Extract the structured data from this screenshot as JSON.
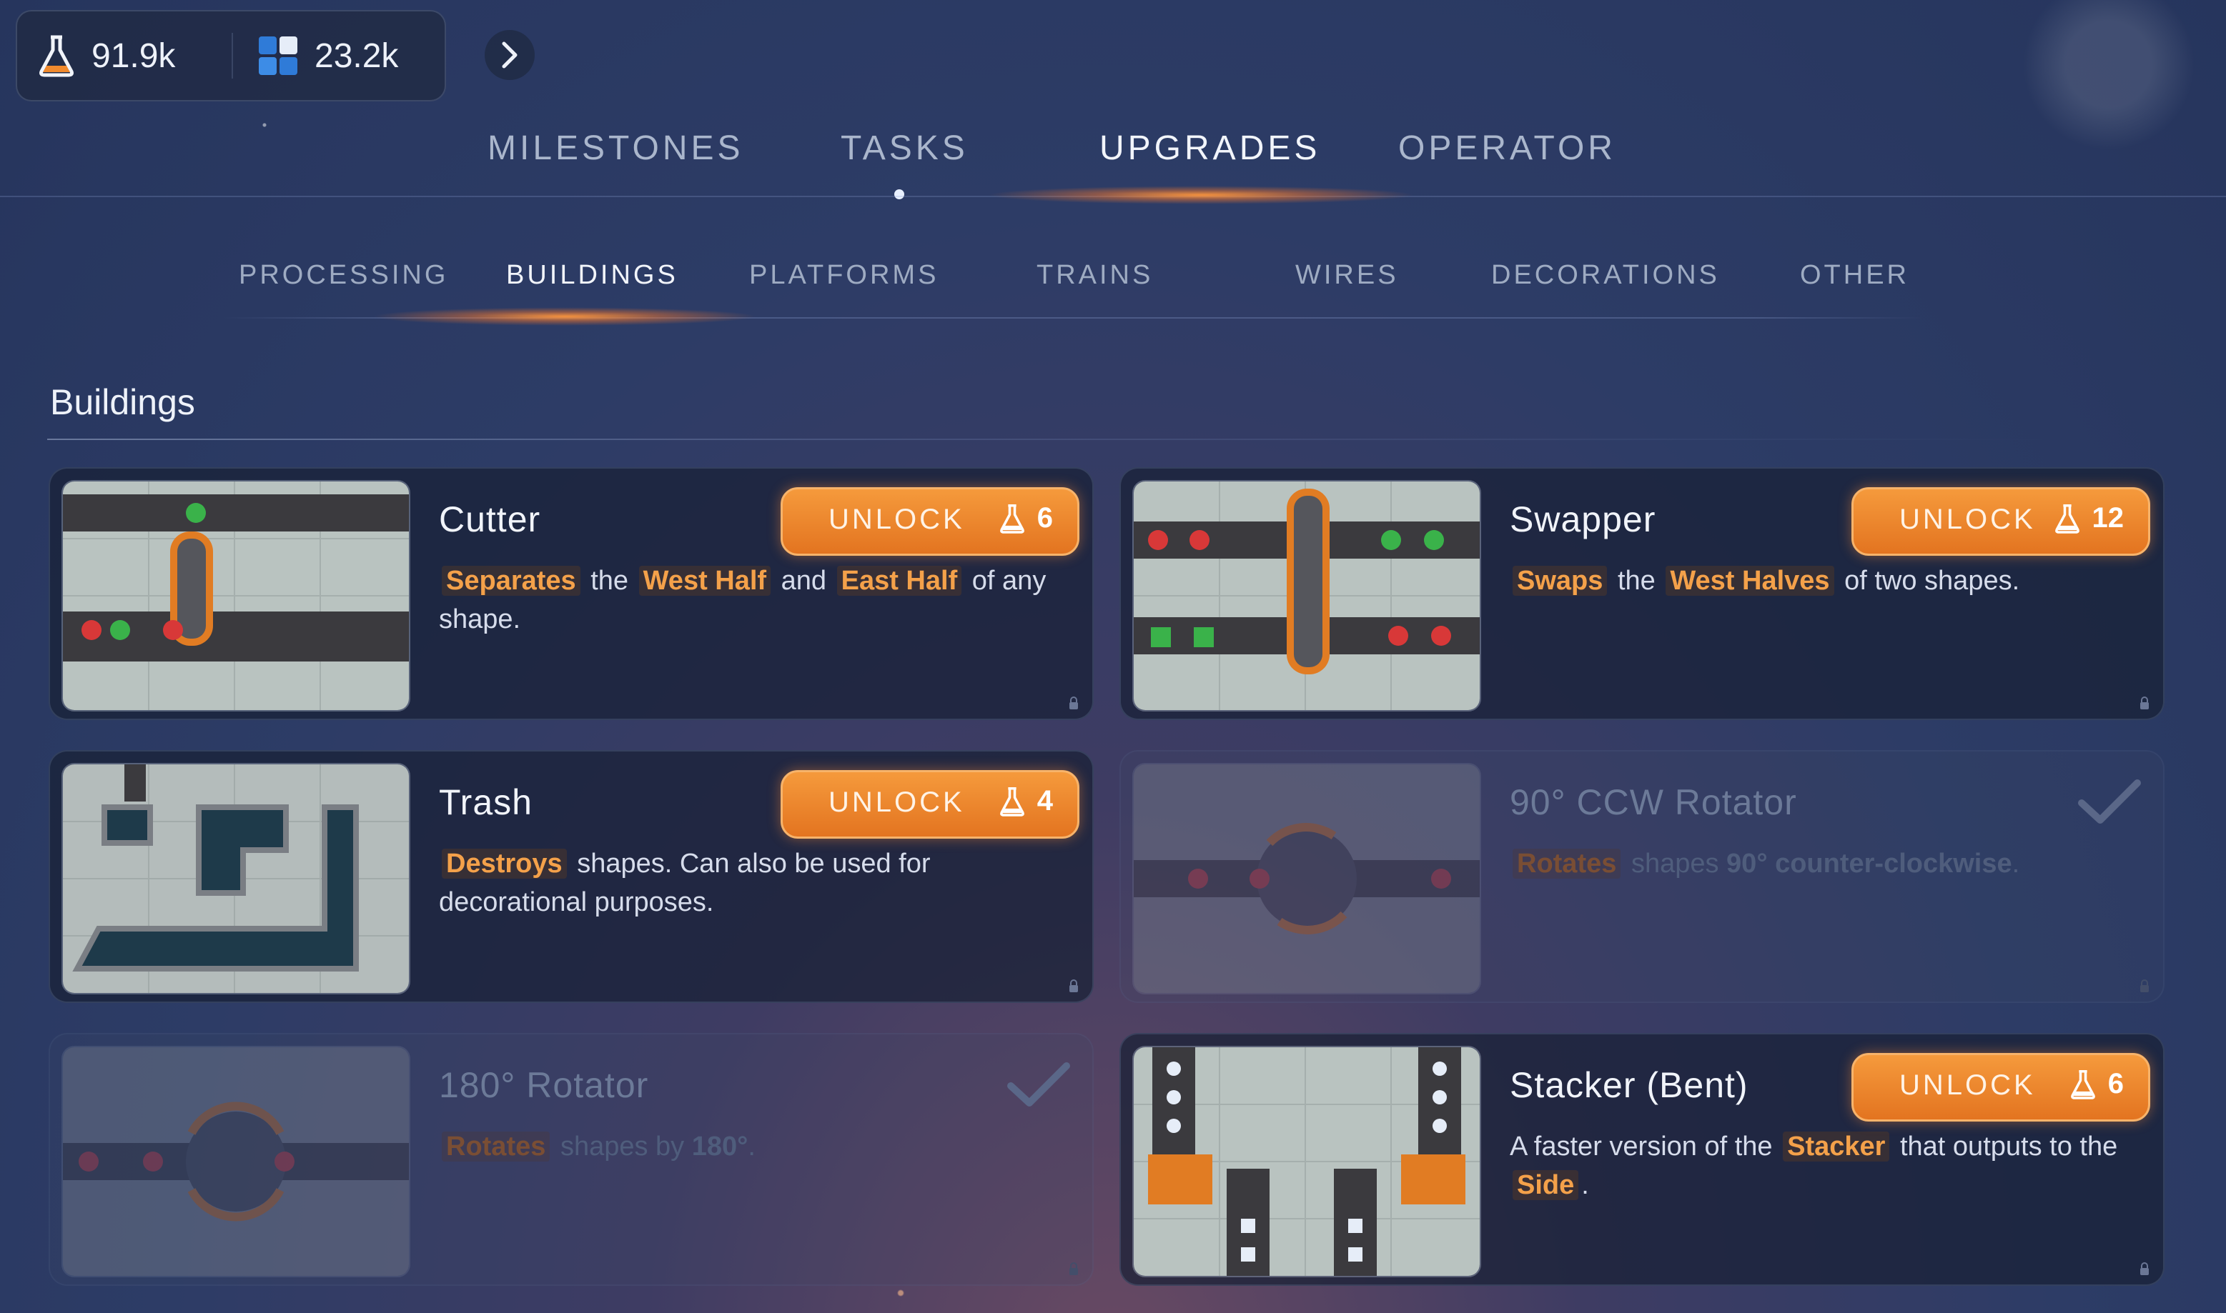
{
  "resources": {
    "research": {
      "icon": "flask-icon",
      "value": "91.9k"
    },
    "shapes": {
      "icon": "shapes-icon",
      "value": "23.2k"
    }
  },
  "main_tabs": [
    "MILESTONES",
    "TASKS",
    "UPGRADES",
    "OPERATOR"
  ],
  "main_active": "UPGRADES",
  "sub_tabs": [
    "PROCESSING",
    "BUILDINGS",
    "PLATFORMS",
    "TRAINS",
    "WIRES",
    "DECORATIONS",
    "OTHER"
  ],
  "sub_active": "BUILDINGS",
  "section_title": "Buildings",
  "colors": {
    "accent": "#f08a2e",
    "highlight": "#f4a14a",
    "panel": "#18203a"
  },
  "cards": [
    {
      "title": "Cutter",
      "status": "locked",
      "unlock_label": "UNLOCK",
      "cost": "6",
      "desc": {
        "hl1": "Separates",
        "t1": "the",
        "hl2": "West Half",
        "t2": "and",
        "hl3": "East Half",
        "t3": "of any shape."
      }
    },
    {
      "title": "Swapper",
      "status": "locked",
      "unlock_label": "UNLOCK",
      "cost": "12",
      "desc": {
        "hl1": "Swaps",
        "t1": "the",
        "hl2": "West Halves",
        "t2": "of two shapes."
      }
    },
    {
      "title": "Trash",
      "status": "locked",
      "unlock_label": "UNLOCK",
      "cost": "4",
      "desc": {
        "hl1": "Destroys",
        "t1": "shapes. Can also be used for decorational purposes."
      }
    },
    {
      "title": "90° CCW Rotator",
      "status": "unlocked",
      "desc": {
        "hl1": "Rotates",
        "t1": "shapes",
        "strong": "90° counter-clockwise",
        "t2": "."
      }
    },
    {
      "title": "180° Rotator",
      "status": "unlocked",
      "desc": {
        "hl1": "Rotates",
        "t1": "shapes by",
        "strong": "180°",
        "t2": "."
      }
    },
    {
      "title": "Stacker (Bent)",
      "status": "locked",
      "unlock_label": "UNLOCK",
      "cost": "6",
      "desc": {
        "t1": "A faster version of the",
        "hl1": "Stacker",
        "t2": "that outputs to the",
        "hl2": "Side",
        "t3": "."
      }
    }
  ]
}
